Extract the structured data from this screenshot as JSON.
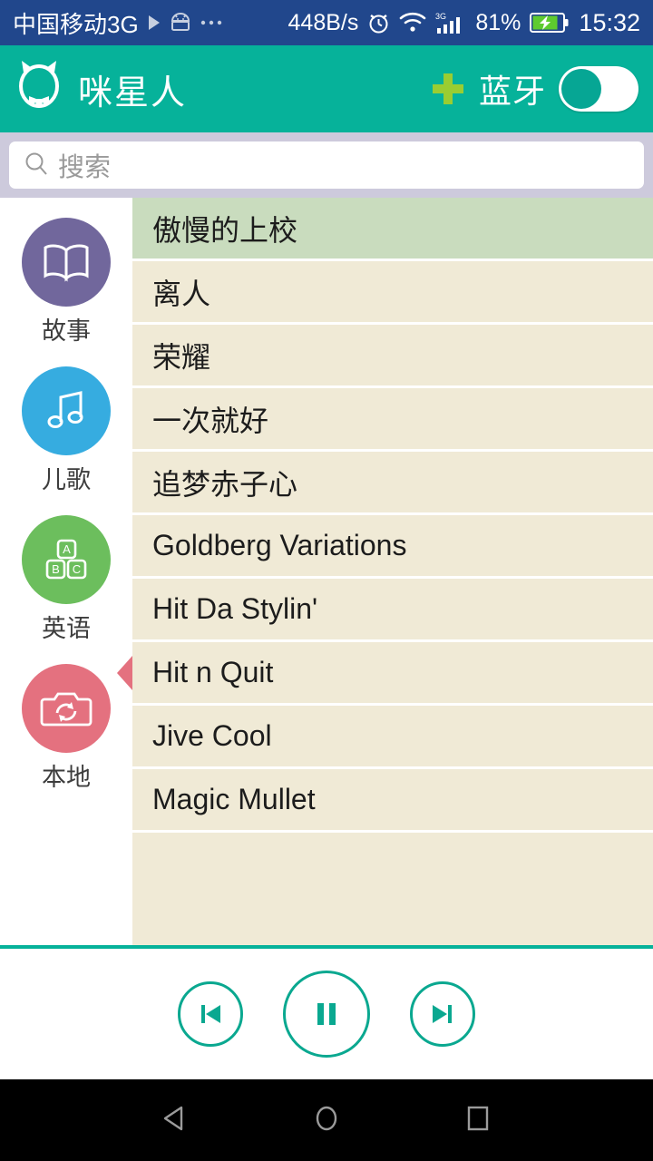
{
  "status_bar": {
    "carrier": "中国移动3G",
    "icons_left": [
      "play-icon",
      "android-robot-icon",
      "more-dots-icon"
    ],
    "network_speed": "448B/s",
    "icons_right": [
      "alarm-icon",
      "wifi-icon",
      "signal-3g-icon"
    ],
    "battery_percent": "81%",
    "battery_icon": "battery-charging-icon",
    "clock": "15:32",
    "bg_color": "#21478c"
  },
  "app_bar": {
    "logo_icon": "cat-face-logo-icon",
    "title": "咪星人",
    "add_icon": "plus-icon",
    "bluetooth_label": "蓝牙",
    "bluetooth_toggle_on": false,
    "bg_color": "#06b29a",
    "plus_color": "#9acd32"
  },
  "search": {
    "icon": "search-icon",
    "placeholder": "搜索",
    "value": "",
    "band_color": "#cdcadc"
  },
  "sidebar": {
    "items": [
      {
        "label": "故事",
        "icon": "open-book-icon",
        "color": "#71679c",
        "selected": false
      },
      {
        "label": "儿歌",
        "icon": "music-note-icon",
        "color": "#36ace0",
        "selected": false
      },
      {
        "label": "英语",
        "icon": "abc-blocks-icon",
        "color": "#6cbe5d",
        "selected": false
      },
      {
        "label": "本地",
        "icon": "camera-sync-icon",
        "color": "#e4717f",
        "selected": true
      }
    ]
  },
  "list": {
    "rows": [
      {
        "title": "傲慢的上校",
        "selected": true
      },
      {
        "title": "离人",
        "selected": false
      },
      {
        "title": "荣耀",
        "selected": false
      },
      {
        "title": "一次就好",
        "selected": false
      },
      {
        "title": "追梦赤子心",
        "selected": false
      },
      {
        "title": "Goldberg Variations",
        "selected": false
      },
      {
        "title": "Hit Da Stylin'",
        "selected": false
      },
      {
        "title": "Hit n Quit",
        "selected": false
      },
      {
        "title": "Jive Cool",
        "selected": false
      },
      {
        "title": "Magic Mullet",
        "selected": false
      }
    ],
    "row_color": "#f0ead6",
    "selected_color": "#c9dcbe"
  },
  "player": {
    "previous_icon": "skip-previous-icon",
    "play_pause_icon": "pause-icon",
    "next_icon": "skip-next-icon",
    "accent_color": "#0aa890"
  },
  "nav_bar": {
    "back_icon": "back-triangle-icon",
    "home_icon": "home-circle-icon",
    "recents_icon": "recents-square-icon"
  }
}
